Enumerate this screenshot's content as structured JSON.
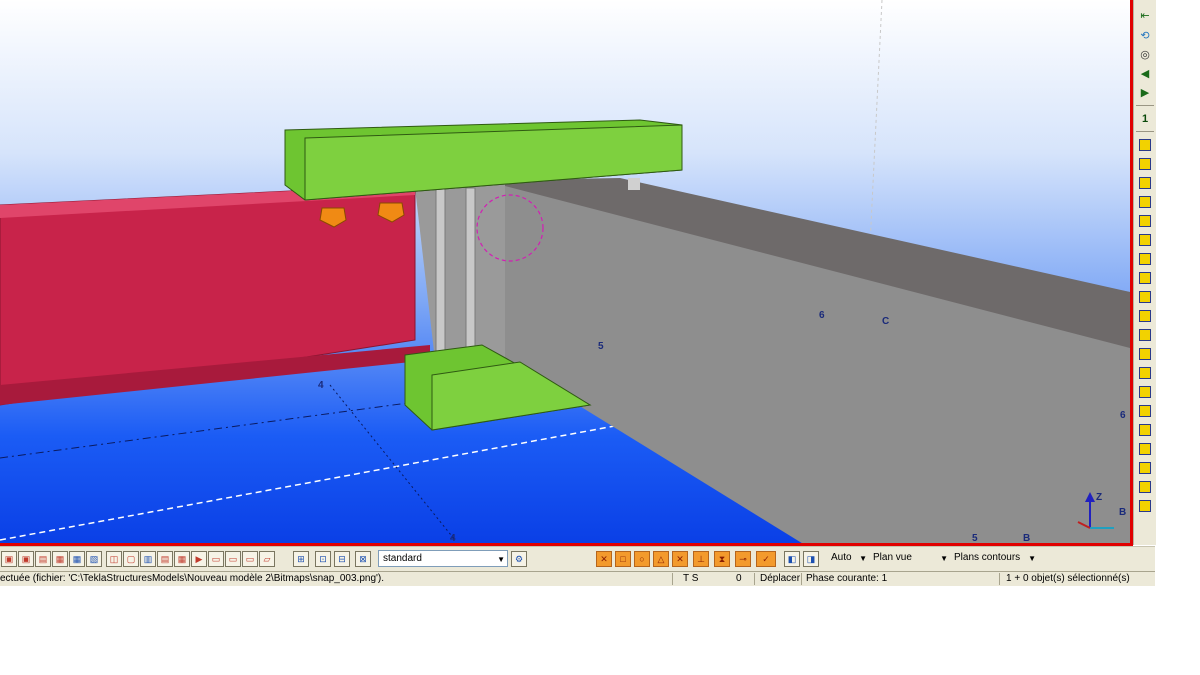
{
  "viewport": {
    "grid_labels": {
      "label_4a": "4",
      "label_4b": "4",
      "label_5a": "5",
      "label_5b": "5",
      "label_6a": "6",
      "label_6b": "6",
      "label_c": "C",
      "label_b1": "B",
      "label_b2": "B"
    },
    "axis": {
      "z": "Z"
    },
    "colors": {
      "red_beam": "#c8234a",
      "green_plate": "#6ec531",
      "concrete": "#8c8c8c",
      "bolt": "#f08a14",
      "frame": "#e00000"
    }
  },
  "right_toolbar": {
    "icons": [
      "snap-icon",
      "refresh-icon",
      "binoculars-icon",
      "arrow-left-icon",
      "arrow-right-icon",
      "number-one-icon",
      "beam-icon-1",
      "beam-icon-2",
      "beam-icon-3",
      "beam-icon-4",
      "beam-icon-5",
      "beam-icon-6",
      "beam-icon-7",
      "beam-icon-8",
      "beam-icon-9",
      "beam-icon-10",
      "beam-icon-11",
      "beam-icon-12",
      "beam-icon-13",
      "beam-icon-14",
      "beam-icon-15",
      "beam-icon-16",
      "beam-icon-17",
      "beam-icon-18",
      "beam-icon-19",
      "beam-icon-20"
    ]
  },
  "bottom_toolbar": {
    "filter_combo": "standard",
    "auto_combo": "Auto",
    "plane_combo": "Plan vue",
    "contour_combo": "Plans contours"
  },
  "status_bar": {
    "message": "ectuée (fichier: 'C:\\TeklaStructuresModels\\Nouveau modèle 2\\Bitmaps\\snap_003.png').",
    "ts": "T S",
    "count": "0",
    "action": "Déplacer",
    "phase": "Phase courante: 1",
    "selection": "1 + 0 objet(s) sélectionné(s)"
  }
}
